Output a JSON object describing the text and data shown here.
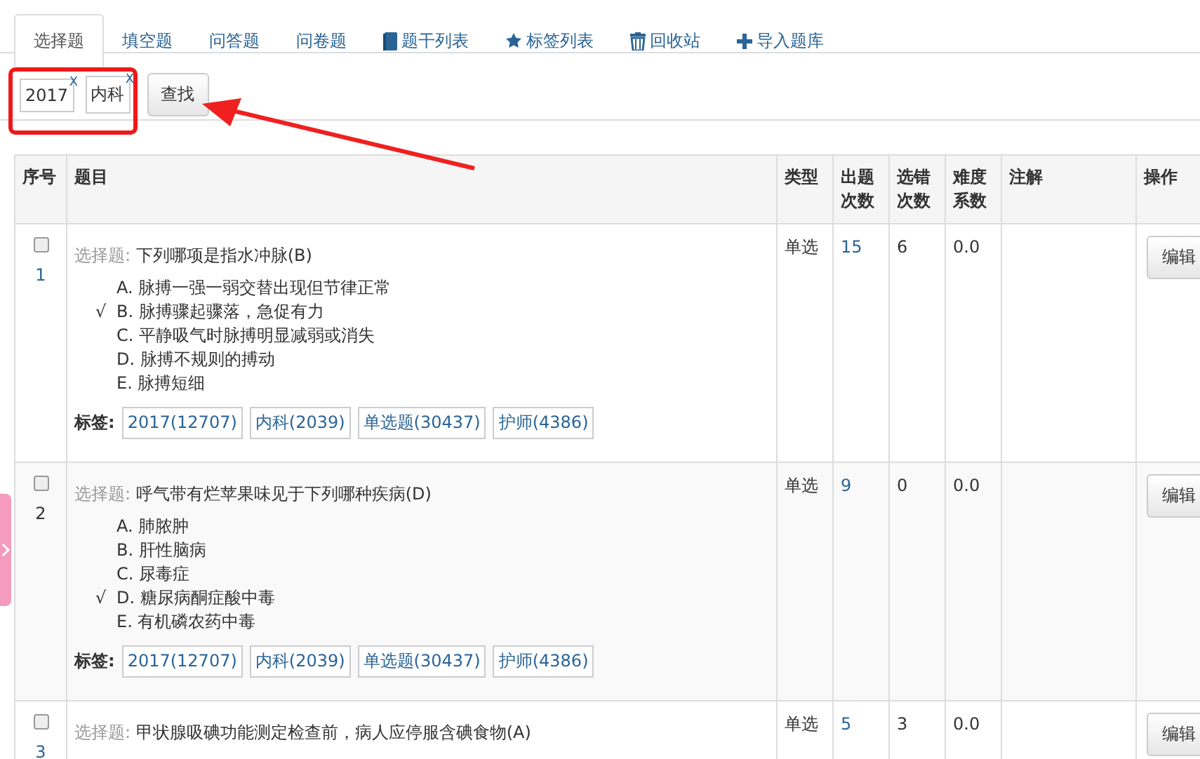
{
  "tabs": [
    {
      "label": "选择题",
      "selected": true
    },
    {
      "label": "填空题",
      "selected": false
    },
    {
      "label": "问答题",
      "selected": false
    },
    {
      "label": "问卷题",
      "selected": false
    },
    {
      "label": "题干列表",
      "selected": false,
      "kind": "book"
    },
    {
      "label": "标签列表",
      "selected": false,
      "kind": "star"
    },
    {
      "label": "回收站",
      "selected": false,
      "kind": "trash"
    },
    {
      "label": "导入题库",
      "selected": false,
      "kind": "plus"
    }
  ],
  "filter": {
    "tags": [
      {
        "label": "2017",
        "remove": "X"
      },
      {
        "label": "内科",
        "remove": "X"
      }
    ],
    "search_button": "查找"
  },
  "table": {
    "columns": [
      "序号",
      "题目",
      "类型",
      "出题次数",
      "选错次数",
      "难度系数",
      "注解",
      "操作"
    ],
    "rows": [
      {
        "checked": false,
        "number": "1",
        "prefix": "选择题:",
        "title": "下列哪项是指水冲脉(B)",
        "options": [
          {
            "label": "A. 脉搏一强一弱交替出现但节律正常"
          },
          {
            "label": "B. 脉搏骤起骤落，急促有力",
            "mark": "√"
          },
          {
            "label": "C. 平静吸气时脉搏明显减弱或消失"
          },
          {
            "label": "D. 脉搏不规则的搏动"
          },
          {
            "label": "E. 脉搏短细"
          }
        ],
        "tags_label": "标签:",
        "tags": [
          "2017(12707)",
          "内科(2039)",
          "单选题(30437)",
          "护师(4386)"
        ],
        "type": "单选",
        "times": "15",
        "wrong": "6",
        "difficulty": "0.0",
        "action": "编辑"
      },
      {
        "checked": false,
        "number": "2",
        "prefix": "选择题:",
        "title": "呼气带有烂苹果味见于下列哪种疾病(D)",
        "options": [
          {
            "label": "A. 肺脓肿"
          },
          {
            "label": "B. 肝性脑病"
          },
          {
            "label": "C. 尿毒症"
          },
          {
            "label": "D. 糖尿病酮症酸中毒",
            "mark": "√"
          },
          {
            "label": "E. 有机磷农药中毒"
          }
        ],
        "tags_label": "标签:",
        "tags": [
          "2017(12707)",
          "内科(2039)",
          "单选题(30437)",
          "护师(4386)"
        ],
        "type": "单选",
        "times": "9",
        "wrong": "0",
        "difficulty": "0.0",
        "action": "编辑"
      },
      {
        "checked": false,
        "number": "3",
        "prefix": "选择题:",
        "title": "甲状腺吸碘功能测定检查前，病人应停服含碘食物(A)",
        "options": [],
        "type": "单选",
        "times": "5",
        "wrong": "3",
        "difficulty": "0.0",
        "action": "编辑"
      }
    ]
  }
}
